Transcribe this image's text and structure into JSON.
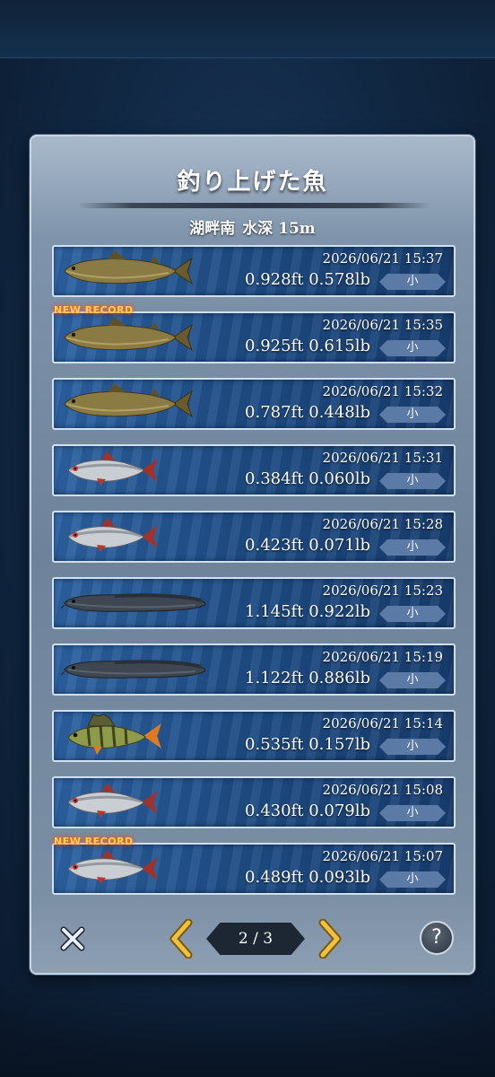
{
  "dialog": {
    "title": "釣り上げた魚",
    "location": "湖畔南",
    "depth": "水深 15m"
  },
  "catches": [
    {
      "fish_icon": "trout-icon",
      "datetime": "2026/06/21 15:37",
      "length": "0.928ft",
      "weight": "0.578lb",
      "size": "小",
      "badge": ""
    },
    {
      "fish_icon": "trout-icon",
      "datetime": "2026/06/21 15:35",
      "length": "0.925ft",
      "weight": "0.615lb",
      "size": "小",
      "badge": "NEW RECORD"
    },
    {
      "fish_icon": "trout-icon",
      "datetime": "2026/06/21 15:32",
      "length": "0.787ft",
      "weight": "0.448lb",
      "size": "小",
      "badge": ""
    },
    {
      "fish_icon": "roach-icon",
      "datetime": "2026/06/21 15:31",
      "length": "0.384ft",
      "weight": "0.060lb",
      "size": "小",
      "badge": ""
    },
    {
      "fish_icon": "roach-icon",
      "datetime": "2026/06/21 15:28",
      "length": "0.423ft",
      "weight": "0.071lb",
      "size": "小",
      "badge": ""
    },
    {
      "fish_icon": "burbot-icon",
      "datetime": "2026/06/21 15:23",
      "length": "1.145ft",
      "weight": "0.922lb",
      "size": "小",
      "badge": ""
    },
    {
      "fish_icon": "burbot-icon",
      "datetime": "2026/06/21 15:19",
      "length": "1.122ft",
      "weight": "0.886lb",
      "size": "小",
      "badge": ""
    },
    {
      "fish_icon": "perch-icon",
      "datetime": "2026/06/21 15:14",
      "length": "0.535ft",
      "weight": "0.157lb",
      "size": "小",
      "badge": ""
    },
    {
      "fish_icon": "roach-icon",
      "datetime": "2026/06/21 15:08",
      "length": "0.430ft",
      "weight": "0.079lb",
      "size": "小",
      "badge": ""
    },
    {
      "fish_icon": "roach-icon",
      "datetime": "2026/06/21 15:07",
      "length": "0.489ft",
      "weight": "0.093lb",
      "size": "小",
      "badge": "NEW RECORD"
    }
  ],
  "pagination": {
    "indicator": "2 / 3",
    "current_page": 2,
    "total_pages": 3
  },
  "controls": {
    "help_label": "?",
    "close_icon": "close-icon",
    "prev_icon": "chevron-left-icon",
    "next_icon": "chevron-right-icon"
  },
  "colors": {
    "accent_gold": "#f0c040",
    "row_blue": "#1f4d86",
    "badge_blue": "#5c7aa6",
    "new_record": "#ffcf5a"
  }
}
